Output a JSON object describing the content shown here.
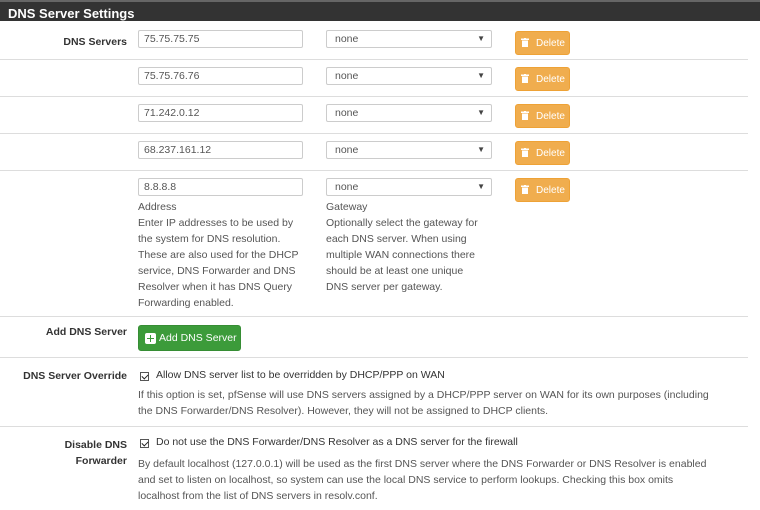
{
  "panel": {
    "title": "DNS Server Settings"
  },
  "dns_servers": {
    "label": "DNS Servers",
    "entries": [
      {
        "address": "75.75.75.75",
        "gateway": "none",
        "delete_label": "Delete"
      },
      {
        "address": "75.75.76.76",
        "gateway": "none",
        "delete_label": "Delete"
      },
      {
        "address": "71.242.0.12",
        "gateway": "none",
        "delete_label": "Delete"
      },
      {
        "address": "68.237.161.12",
        "gateway": "none",
        "delete_label": "Delete"
      },
      {
        "address": "8.8.8.8",
        "gateway": "none",
        "delete_label": "Delete"
      }
    ],
    "address_help_title": "Address",
    "address_help_lines": [
      "Enter IP addresses to be used by",
      "the system for DNS resolution.",
      "These are also used for the DHCP",
      "service, DNS Forwarder and DNS",
      "Resolver when it has DNS Query",
      "Forwarding enabled."
    ],
    "gateway_help_title": "Gateway",
    "gateway_help_lines": [
      "Optionally select the gateway for",
      "each DNS server. When using",
      "multiple WAN connections there",
      "should be at least one unique",
      "DNS server per gateway."
    ]
  },
  "add_dns": {
    "label": "Add DNS Server",
    "button_label": "Add DNS Server"
  },
  "override": {
    "label": "DNS Server Override",
    "checkbox_label": "Allow DNS server list to be overridden by DHCP/PPP on WAN",
    "checked": true,
    "help_lines": [
      "If this option is set, pfSense will use DNS servers assigned by a DHCP/PPP server on WAN for its own purposes (including",
      "the DNS Forwarder/DNS Resolver). However, they will not be assigned to DHCP clients."
    ]
  },
  "disable_forwarder": {
    "label_line1": "Disable DNS",
    "label_line2": "Forwarder",
    "checkbox_label": "Do not use the DNS Forwarder/DNS Resolver as a DNS server for the firewall",
    "checked": true,
    "help_lines": [
      "By default localhost (127.0.0.1) will be used as the first DNS server where the DNS Forwarder or DNS Resolver is enabled",
      "and set to listen on localhost, so system can use the local DNS service to perform lookups. Checking this box omits",
      "localhost from the list of DNS servers in resolv.conf."
    ]
  },
  "colors": {
    "header_bg": "#333333",
    "delete_btn": "#f0ad4e",
    "add_btn": "#3c9b3a"
  }
}
